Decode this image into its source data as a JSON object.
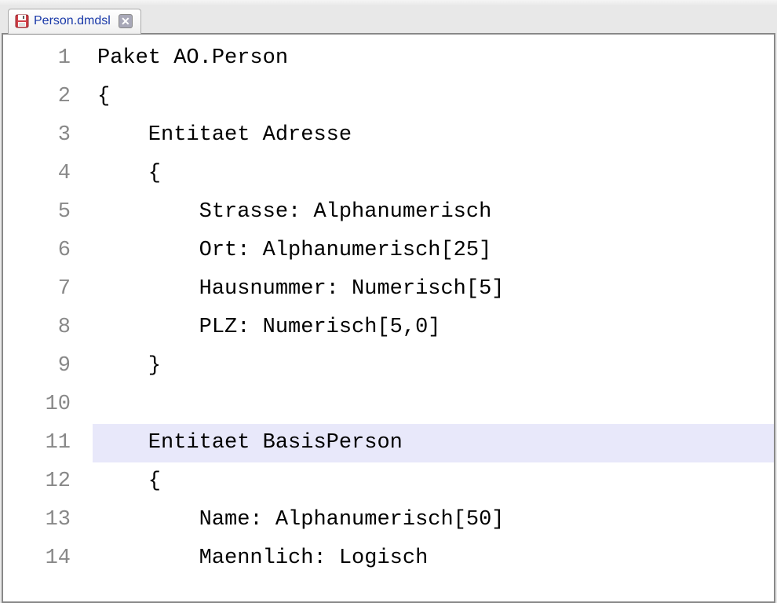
{
  "tab": {
    "filename": "Person.dmdsl"
  },
  "editor": {
    "highlight_line": 11,
    "lines": [
      {
        "num": 1,
        "text": "Paket AO.Person"
      },
      {
        "num": 2,
        "text": "{"
      },
      {
        "num": 3,
        "text": "    Entitaet Adresse"
      },
      {
        "num": 4,
        "text": "    {"
      },
      {
        "num": 5,
        "text": "        Strasse: Alphanumerisch"
      },
      {
        "num": 6,
        "text": "        Ort: Alphanumerisch[25]"
      },
      {
        "num": 7,
        "text": "        Hausnummer: Numerisch[5]"
      },
      {
        "num": 8,
        "text": "        PLZ: Numerisch[5,0]"
      },
      {
        "num": 9,
        "text": "    }"
      },
      {
        "num": 10,
        "text": ""
      },
      {
        "num": 11,
        "text": "    Entitaet BasisPerson"
      },
      {
        "num": 12,
        "text": "    {"
      },
      {
        "num": 13,
        "text": "        Name: Alphanumerisch[50]"
      },
      {
        "num": 14,
        "text": "        Maennlich: Logisch"
      }
    ]
  }
}
